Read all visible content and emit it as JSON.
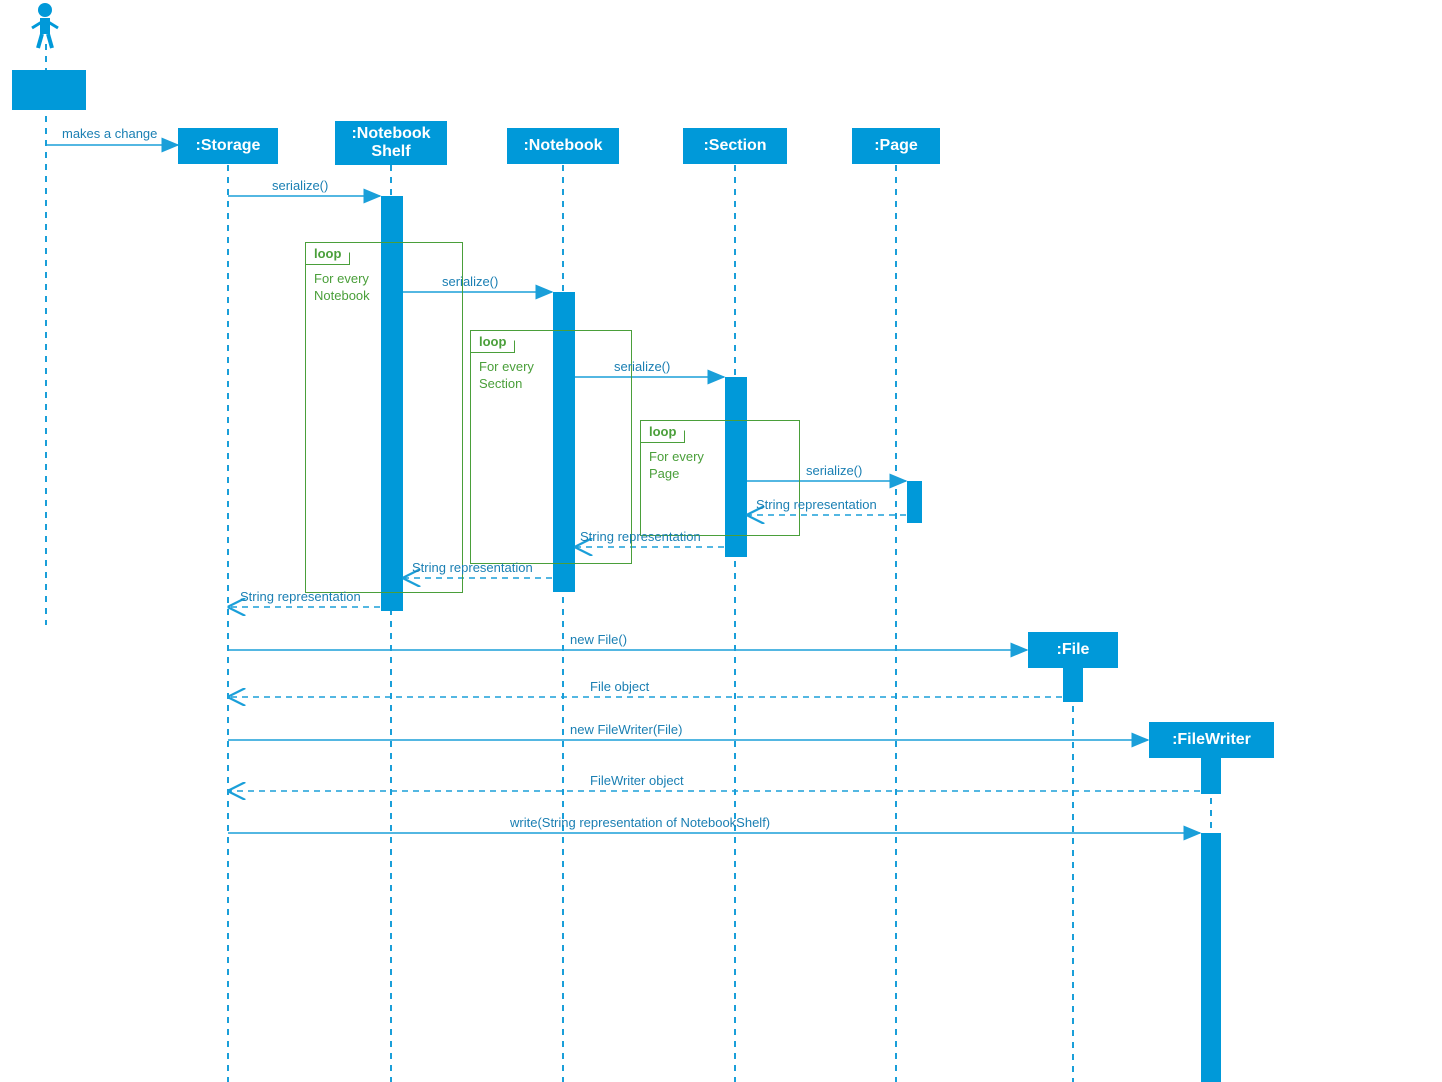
{
  "participants": {
    "actor": {
      "label": ""
    },
    "storage": {
      "label": ":Storage"
    },
    "notebookShelf": {
      "label": ":Notebook\nShelf"
    },
    "notebook": {
      "label": ":Notebook"
    },
    "section": {
      "label": ":Section"
    },
    "page": {
      "label": ":Page"
    },
    "file": {
      "label": ":File"
    },
    "fileWriter": {
      "label": ":FileWriter"
    }
  },
  "loops": {
    "l1": {
      "title": "loop",
      "condition": "For every\nNotebook"
    },
    "l2": {
      "title": "loop",
      "condition": "For every\nSection"
    },
    "l3": {
      "title": "loop",
      "condition": "For every\nPage"
    }
  },
  "messages": {
    "m1": "makes a change",
    "m2": "serialize()",
    "m3": "serialize()",
    "m4": "serialize()",
    "m5": "serialize()",
    "m6": "String representation",
    "m7": "String representation",
    "m8": "String representation",
    "m9": "String representation",
    "m10": "new File()",
    "m11": "File object",
    "m12": "new FileWriter(File)",
    "m13": "FileWriter object",
    "m14": "write(String representation of NotebookShelf)"
  },
  "colors": {
    "primary": "#0099d9",
    "line": "#1a9fd9",
    "loop": "#4a9f3a",
    "text": "#1a7fb3"
  }
}
